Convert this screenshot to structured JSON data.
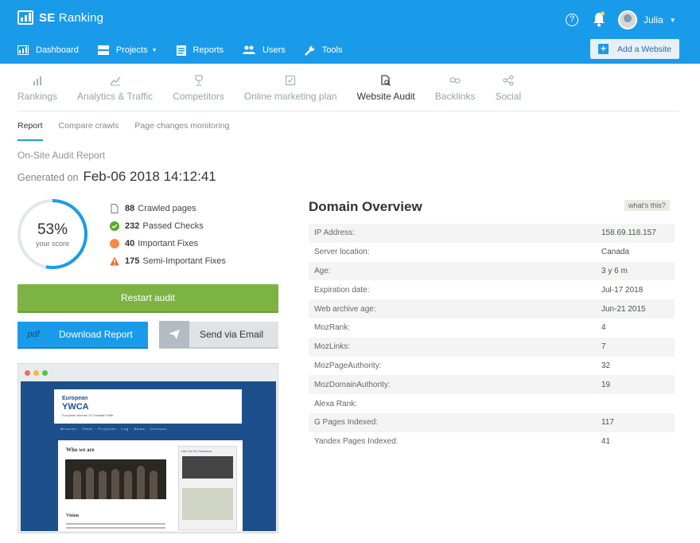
{
  "app": {
    "brand_bold": "SE",
    "brand_rest": " Ranking"
  },
  "header": {
    "user_name": "Julia",
    "nav": [
      {
        "label": "Dashboard",
        "icon": "dashboard-icon"
      },
      {
        "label": "Projects",
        "icon": "projects-icon"
      },
      {
        "label": "Reports",
        "icon": "reports-icon"
      },
      {
        "label": "Users",
        "icon": "users-icon"
      },
      {
        "label": "Tools",
        "icon": "tools-icon"
      }
    ],
    "add_website_label": "Add a Website"
  },
  "module_tabs": [
    {
      "label": "Rankings",
      "icon": "rankings-icon"
    },
    {
      "label": "Analytics & Traffic",
      "icon": "analytics-icon"
    },
    {
      "label": "Competitors",
      "icon": "trophy-icon"
    },
    {
      "label": "Online marketing plan",
      "icon": "checklist-icon"
    },
    {
      "label": "Website Audit",
      "icon": "audit-icon",
      "active": true
    },
    {
      "label": "Backlinks",
      "icon": "backlinks-icon"
    },
    {
      "label": "Social",
      "icon": "share-icon"
    }
  ],
  "sub_tabs": [
    {
      "label": "Report",
      "active": true
    },
    {
      "label": "Compare crawls"
    },
    {
      "label": "Page changes monitoring"
    }
  ],
  "report": {
    "title": "On-Site Audit Report",
    "generated_label": "Generated on",
    "generated_value": "Feb-06 2018 14:12:41",
    "score": 53,
    "score_text": "53%",
    "score_sub": "your score",
    "stats": [
      {
        "count": "88",
        "label": "Crawled pages",
        "icon": "page-icon"
      },
      {
        "count": "232",
        "label": "Passed Checks",
        "icon": "check-circle-icon"
      },
      {
        "count": "40",
        "label": "Important Fixes",
        "icon": "orange-dot-icon"
      },
      {
        "count": "175",
        "label": "Semi-Important Fixes",
        "icon": "warning-triangle-icon"
      }
    ],
    "restart_label": "Restart audit",
    "download_label": "Download Report",
    "download_prefix": "pdf",
    "email_label": "Send via Email"
  },
  "preview": {
    "site_brand_top": "European",
    "site_brand": "YWCA",
    "site_tagline": "European Women Of Christian Faith",
    "menu_text": "Mission · Team · Projects · Log · News · Contact",
    "content_title": "Who we are",
    "vision_title": "Vision",
    "fb_title": "Like Us On Facebook"
  },
  "domain_overview": {
    "title": "Domain Overview",
    "whats_this": "what's this?",
    "rows": [
      {
        "key": "IP Address:",
        "value": "158.69.118.157"
      },
      {
        "key": "Server location:",
        "value": "Canada"
      },
      {
        "key": "Age:",
        "value": "3 y 6 m"
      },
      {
        "key": "Expiration date:",
        "value": "Jul-17 2018"
      },
      {
        "key": "Web archive age:",
        "value": "Jun-21 2015"
      },
      {
        "key": "MozRank:",
        "value": "4"
      },
      {
        "key": "MozLinks:",
        "value": "7"
      },
      {
        "key": "MozPageAuthority:",
        "value": "32"
      },
      {
        "key": "MozDomainAuthority:",
        "value": "19"
      },
      {
        "key": "Alexa Rank:",
        "value": ""
      },
      {
        "key": "G Pages Indexed:",
        "value": "117"
      },
      {
        "key": "Yandex Pages Indexed:",
        "value": "41"
      }
    ]
  },
  "colors": {
    "header_blue": "#1a9bea",
    "restart_green": "#7cb342",
    "check_green": "#5aa72b",
    "important_orange": "#f7884a",
    "warning_orange": "#f26a2a"
  }
}
